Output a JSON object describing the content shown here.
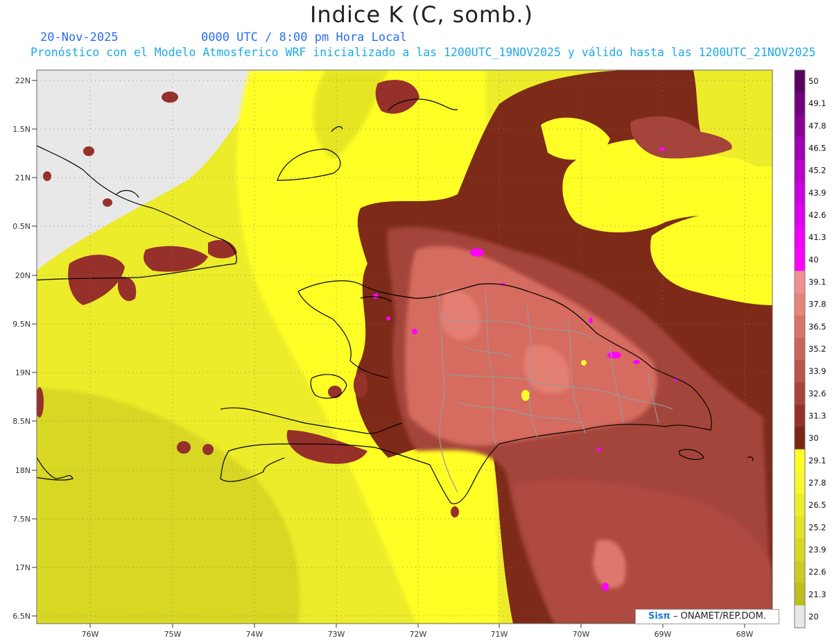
{
  "header": {
    "title": "Indice K (C, somb.)",
    "date": "20-Nov-2025",
    "utc_line": "0000 UTC / 8:00 pm Hora Local",
    "description": "Pronóstico con el Modelo Atmosferico WRF inicializado a las 1200UTC_19NOV2025 y válido hasta las  1200UTC_21NOV2025"
  },
  "axes": {
    "lat_labels": [
      "22N",
      "1.5N",
      "21N",
      "0.5N",
      "20N",
      "9.5N",
      "19N",
      "8.5N",
      "18N",
      "7.5N",
      "17N",
      "6.5N"
    ],
    "lon_labels": [
      "76W",
      "75W",
      "74W",
      "73W",
      "72W",
      "71W",
      "70W",
      "69W",
      "68W"
    ]
  },
  "colorbar": {
    "labels": [
      "50",
      "49.1",
      "47.8",
      "46.5",
      "45.2",
      "43.9",
      "42.6",
      "41.3",
      "40",
      "39.1",
      "37.8",
      "36.5",
      "35.2",
      "33.9",
      "32.6",
      "31.3",
      "30",
      "29.1",
      "27.8",
      "26.5",
      "25.2",
      "23.9",
      "22.6",
      "21.3",
      "20"
    ],
    "colors": [
      "#5a0060",
      "#74007c",
      "#8a0096",
      "#a000b0",
      "#b400c8",
      "#c800dc",
      "#dc00ec",
      "#f000f8",
      "#ff00ff",
      "#f29090",
      "#e88478",
      "#da7468",
      "#cc645a",
      "#bc5448",
      "#aa4438",
      "#96302a",
      "#7a2614",
      "#ffff26",
      "#f8f830",
      "#eeee2c",
      "#e2e228",
      "#d8d824",
      "#cccc20",
      "#bebe1c",
      "#e8e8e8"
    ]
  },
  "credit": {
    "logo": "Sisπ",
    "text": " – ONAMET/REP.DOM."
  },
  "icons": [
    "credit-logo"
  ]
}
